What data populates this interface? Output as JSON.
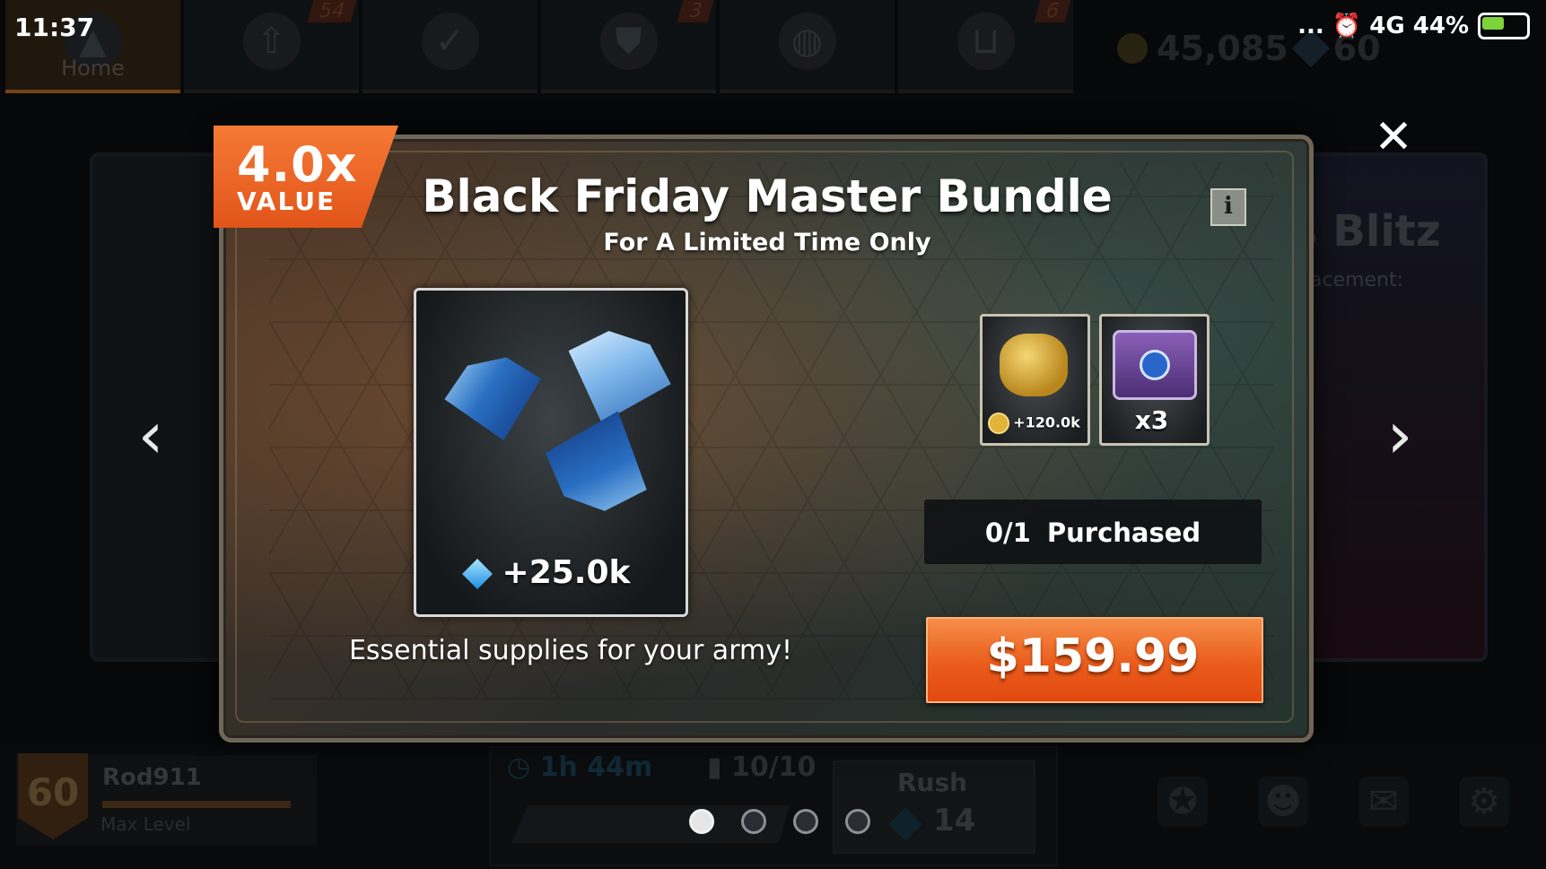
{
  "status_bar": {
    "time": "11:37",
    "indicators": "... ⏰ 4G 44%"
  },
  "top_nav": {
    "tabs": [
      {
        "label": "Home",
        "icon": "rocket-icon",
        "badge": ""
      },
      {
        "label": "",
        "icon": "upgrade-arrow-icon",
        "badge": "54"
      },
      {
        "label": "",
        "icon": "missions-check-icon",
        "badge": ""
      },
      {
        "label": "",
        "icon": "alliance-flag-icon",
        "badge": "3"
      },
      {
        "label": "",
        "icon": "globe-icon",
        "badge": ""
      },
      {
        "label": "",
        "icon": "cart-icon",
        "badge": "6"
      }
    ],
    "gold": "45,085",
    "gems": "60"
  },
  "background_event": {
    "title_partial": "s Blitz",
    "subtitle_partial": "acement:"
  },
  "modal": {
    "value_multiplier": "4.0x",
    "value_label": "VALUE",
    "title": "Black Friday Master Bundle",
    "subtitle": "For A Limited Time Only",
    "main_item_amount": "+25.0k",
    "description": "Essential supplies for your army!",
    "bonus_items": [
      {
        "icon": "gold-coins-icon",
        "label": "+120.0k"
      },
      {
        "icon": "supply-crate-icon",
        "label": "x3"
      }
    ],
    "purchased": "0/1  Purchased",
    "price": "$159.99",
    "close_symbol": "✕",
    "info_symbol": "i",
    "prev_symbol": "‹",
    "next_symbol": "›"
  },
  "bottom_bar": {
    "player_name": "Rod911",
    "player_level": "60",
    "player_status": "Max Level",
    "timer": "1h 44m",
    "capacity": "10/10",
    "rush_label": "Rush",
    "rush_cost": "14",
    "page_dots": 4,
    "active_dot": 0
  },
  "colors": {
    "accent_orange": "#e2541a",
    "price_orange": "#ea5c1c",
    "gem_blue": "#1f8fe0"
  }
}
